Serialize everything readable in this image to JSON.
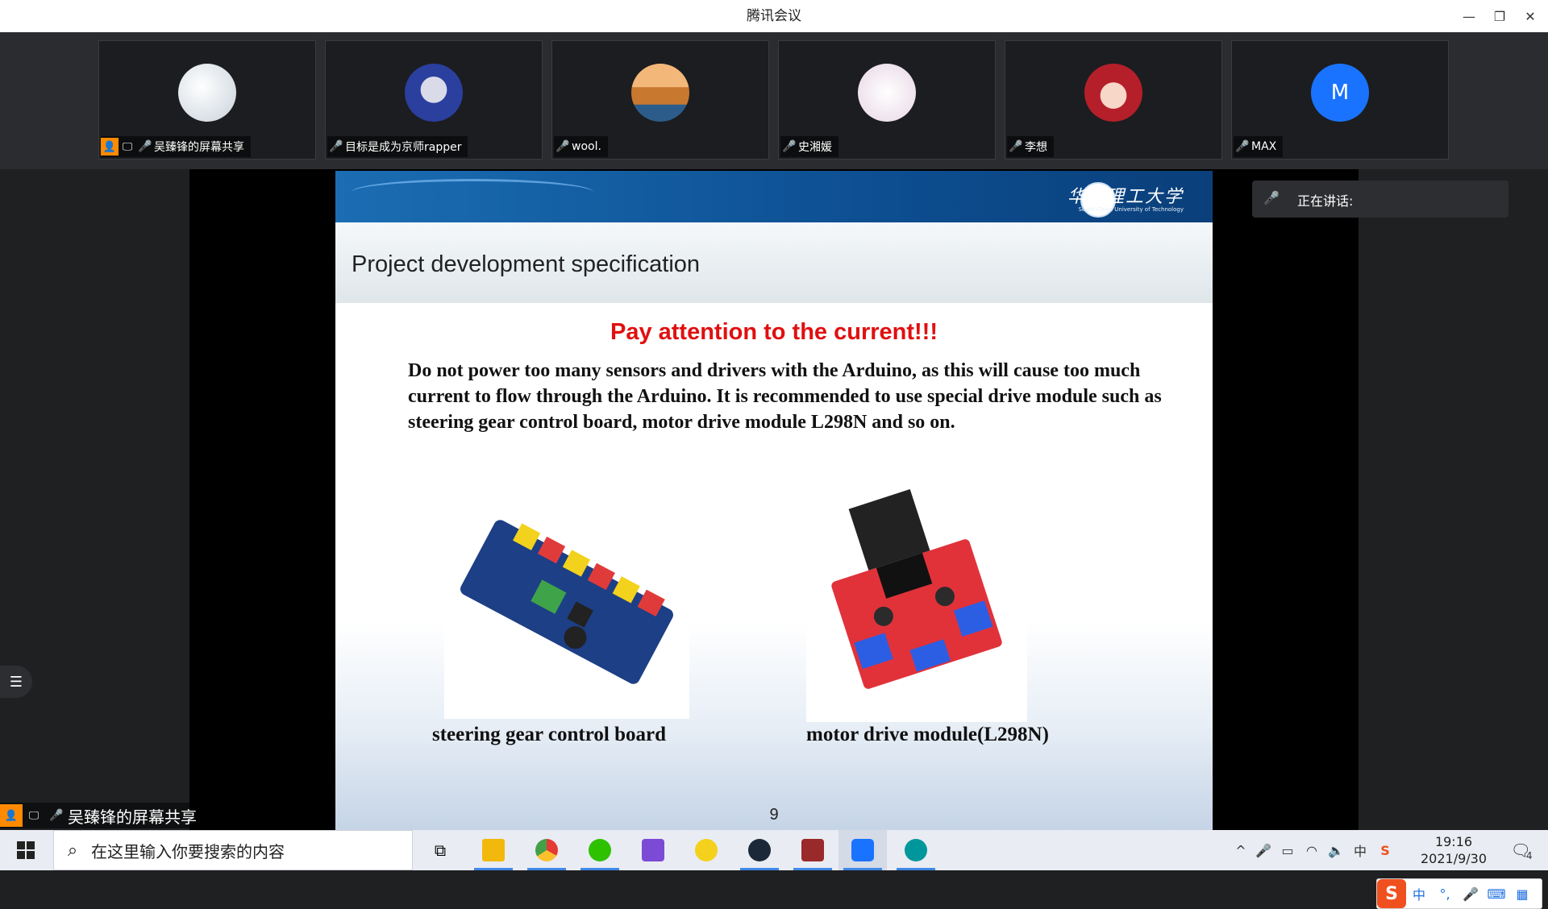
{
  "window": {
    "title": "腾讯会议"
  },
  "participants": [
    {
      "name": "吴臻锋的屏幕共享",
      "avatar_color": "#dfe6ec",
      "sharing": true
    },
    {
      "name": "目标是成为京师rapper",
      "avatar_color": "#2a3f9e"
    },
    {
      "name": "wool.",
      "avatar_color": "#c9782f"
    },
    {
      "name": "史湘媛",
      "avatar_color": "#efe3ec"
    },
    {
      "name": "李想",
      "avatar_color": "#b51f2a"
    },
    {
      "name": "MAX",
      "avatar_color": "#1a73ff",
      "initial": "M"
    }
  ],
  "speaking_panel": {
    "label": "正在讲话:"
  },
  "slide": {
    "university_name": "华南理工大学",
    "university_sub": "South China University of Technology",
    "title": "Project development specification",
    "warning": "Pay attention to the current!!!",
    "body": "Do not power too many sensors and drivers with the Arduino, as this will cause too much current to flow through the Arduino. It is recommended to use special drive module such as steering gear control board, motor drive module L298N and so on.",
    "caption_left": "steering gear control board",
    "caption_right": "motor drive module(L298N)",
    "page_number": "9"
  },
  "share_label": "吴臻锋的屏幕共享",
  "taskbar": {
    "search_placeholder": "在这里输入你要搜索的内容",
    "time": "19:16",
    "date": "2021/9/30",
    "notification_count": "4"
  },
  "ime": {
    "mode": "中"
  },
  "colors": {
    "accent": "#1a73ff",
    "warning": "#e01010",
    "mic_off": "#e94b4b"
  }
}
